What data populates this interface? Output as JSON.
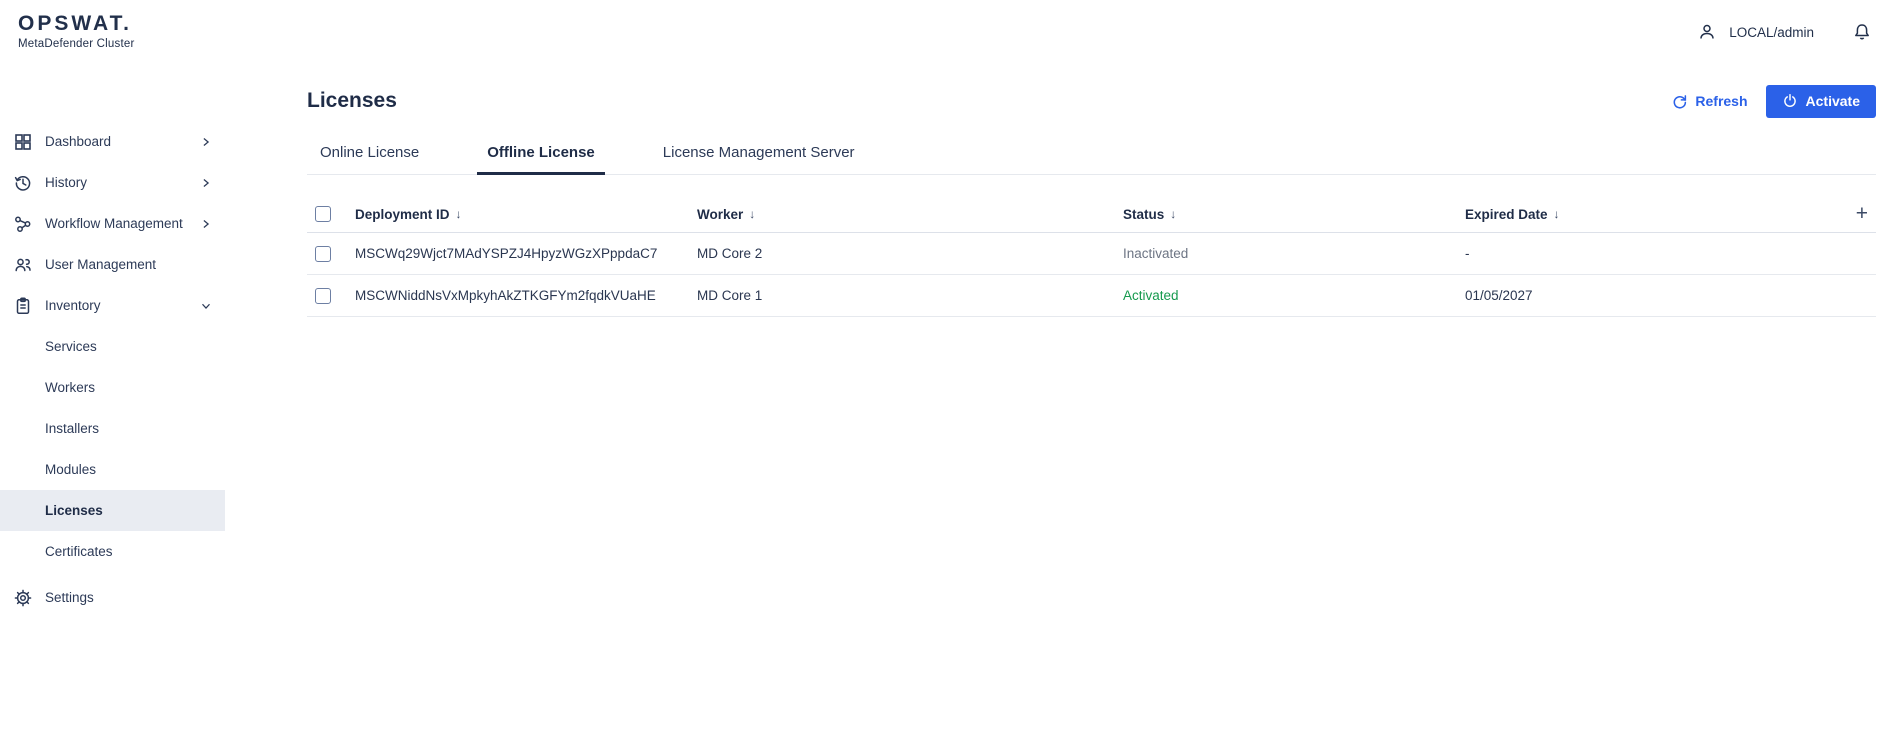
{
  "colors": {
    "accent": "#2b61e8",
    "green": "#169a4e",
    "navy": "#24324e",
    "muted": "#6d7584",
    "selected_bg": "#e9ecf2",
    "border": "#e6e9ee",
    "header_border": "#dde1e9"
  },
  "brand": {
    "logo": "OPSWAT.",
    "subtitle": "MetaDefender Cluster"
  },
  "header": {
    "username": "LOCAL/admin"
  },
  "sidebar": {
    "items": [
      {
        "label": "Dashboard",
        "icon": "dashboard-grid-icon",
        "chevron": "right"
      },
      {
        "label": "History",
        "icon": "history-icon",
        "chevron": "right"
      },
      {
        "label": "Workflow Management",
        "icon": "workflow-icon",
        "chevron": "right"
      },
      {
        "label": "User Management",
        "icon": "users-icon",
        "chevron": "none"
      },
      {
        "label": "Inventory",
        "icon": "inventory-clipboard-icon",
        "chevron": "down",
        "expanded": true
      },
      {
        "label": "Settings",
        "icon": "gear-icon",
        "chevron": "none"
      }
    ],
    "inventory_children": [
      {
        "label": "Services"
      },
      {
        "label": "Workers"
      },
      {
        "label": "Installers"
      },
      {
        "label": "Modules"
      },
      {
        "label": "Licenses",
        "active": true
      },
      {
        "label": "Certificates"
      }
    ]
  },
  "page": {
    "title": "Licenses",
    "actions": {
      "refresh_label": "Refresh",
      "activate_label": "Activate"
    },
    "tabs": [
      {
        "label": "Online License",
        "active": false
      },
      {
        "label": "Offline License",
        "active": true
      },
      {
        "label": "License Management Server",
        "active": false
      }
    ],
    "table": {
      "headers": [
        {
          "label": "Deployment ID"
        },
        {
          "label": "Worker"
        },
        {
          "label": "Status"
        },
        {
          "label": "Expired Date"
        }
      ],
      "rows": [
        {
          "deployment_id": "MSCWq29Wjct7MAdYSPZJ4HpyzWGzXPppdaC7",
          "worker": "MD Core 2",
          "status": "Inactivated",
          "expired_date": "-"
        },
        {
          "deployment_id": "MSCWNiddNsVxMpkyhAkZTKGFYm2fqdkVUaHE",
          "worker": "MD Core 1",
          "status": "Activated",
          "expired_date": "01/05/2027"
        }
      ]
    }
  },
  "icons": {
    "sort": "↓",
    "add_column": "+"
  }
}
